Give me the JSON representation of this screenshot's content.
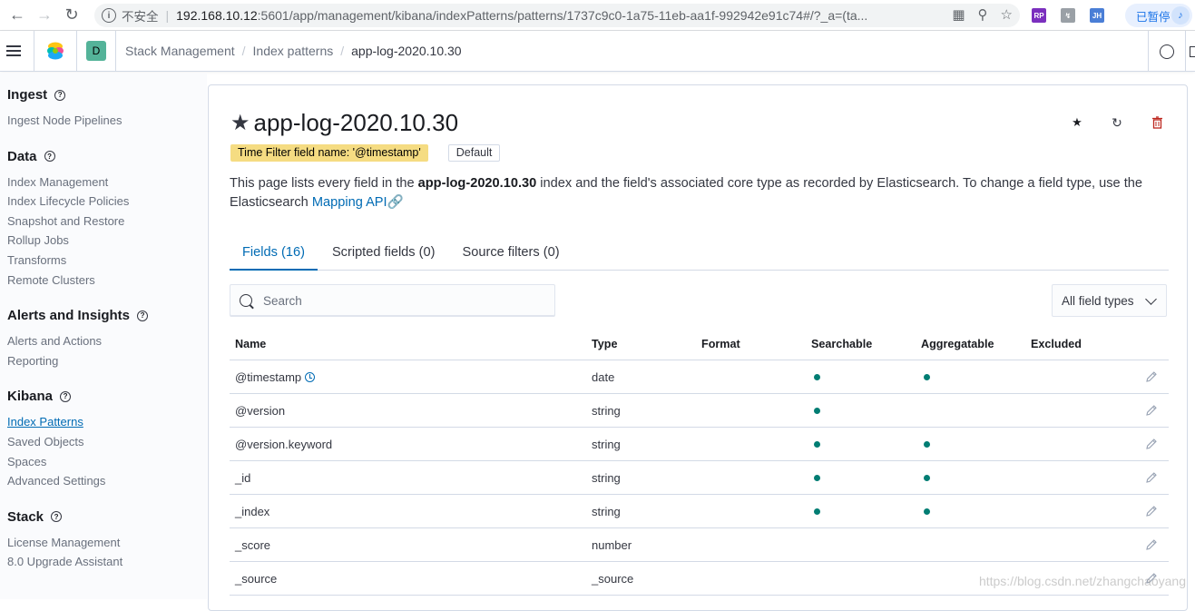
{
  "browser": {
    "insecure_label": "不安全",
    "url_host": "192.168.10.12",
    "url_path": ":5601/app/management/kibana/indexPatterns/patterns/1737c9c0-1a75-11eb-aa1f-992942e91c74#/?_a=(ta...",
    "pause_label": "已暂停",
    "ext1": "RP",
    "ext3": "JH"
  },
  "header": {
    "space_initial": "D",
    "breadcrumbs": [
      "Stack Management",
      "Index patterns",
      "app-log-2020.10.30"
    ]
  },
  "sidebar": {
    "groups": [
      {
        "title": "Ingest",
        "items": [
          "Ingest Node Pipelines"
        ]
      },
      {
        "title": "Data",
        "items": [
          "Index Management",
          "Index Lifecycle Policies",
          "Snapshot and Restore",
          "Rollup Jobs",
          "Transforms",
          "Remote Clusters"
        ]
      },
      {
        "title": "Alerts and Insights",
        "items": [
          "Alerts and Actions",
          "Reporting"
        ]
      },
      {
        "title": "Kibana",
        "items": [
          "Index Patterns",
          "Saved Objects",
          "Spaces",
          "Advanced Settings"
        ]
      },
      {
        "title": "Stack",
        "items": [
          "License Management",
          "8.0 Upgrade Assistant"
        ]
      }
    ],
    "active_item": "Index Patterns"
  },
  "page": {
    "title": "app-log-2020.10.30",
    "time_filter_badge": "Time Filter field name: '@timestamp'",
    "default_badge": "Default",
    "desc_pre": "This page lists every field in the ",
    "desc_index": "app-log-2020.10.30",
    "desc_mid": " index and the field's associated core type as recorded by Elasticsearch. To change a field type, use the Elasticsearch ",
    "desc_link": "Mapping API",
    "tabs": [
      "Fields (16)",
      "Scripted fields (0)",
      "Source filters (0)"
    ],
    "search_placeholder": "Search",
    "filter_select": "All field types"
  },
  "table": {
    "columns": [
      "Name",
      "Type",
      "Format",
      "Searchable",
      "Aggregatable",
      "Excluded"
    ],
    "rows": [
      {
        "name": "@timestamp",
        "type": "date",
        "format": "",
        "searchable": true,
        "aggregatable": true,
        "excluded": false,
        "time": true
      },
      {
        "name": "@version",
        "type": "string",
        "format": "",
        "searchable": true,
        "aggregatable": false,
        "excluded": false
      },
      {
        "name": "@version.keyword",
        "type": "string",
        "format": "",
        "searchable": true,
        "aggregatable": true,
        "excluded": false
      },
      {
        "name": "_id",
        "type": "string",
        "format": "",
        "searchable": true,
        "aggregatable": true,
        "excluded": false
      },
      {
        "name": "_index",
        "type": "string",
        "format": "",
        "searchable": true,
        "aggregatable": true,
        "excluded": false
      },
      {
        "name": "_score",
        "type": "number",
        "format": "",
        "searchable": false,
        "aggregatable": false,
        "excluded": false
      },
      {
        "name": "_source",
        "type": "_source",
        "format": "",
        "searchable": false,
        "aggregatable": false,
        "excluded": false
      }
    ]
  },
  "watermark": "https://blog.csdn.net/zhangchaoyang"
}
